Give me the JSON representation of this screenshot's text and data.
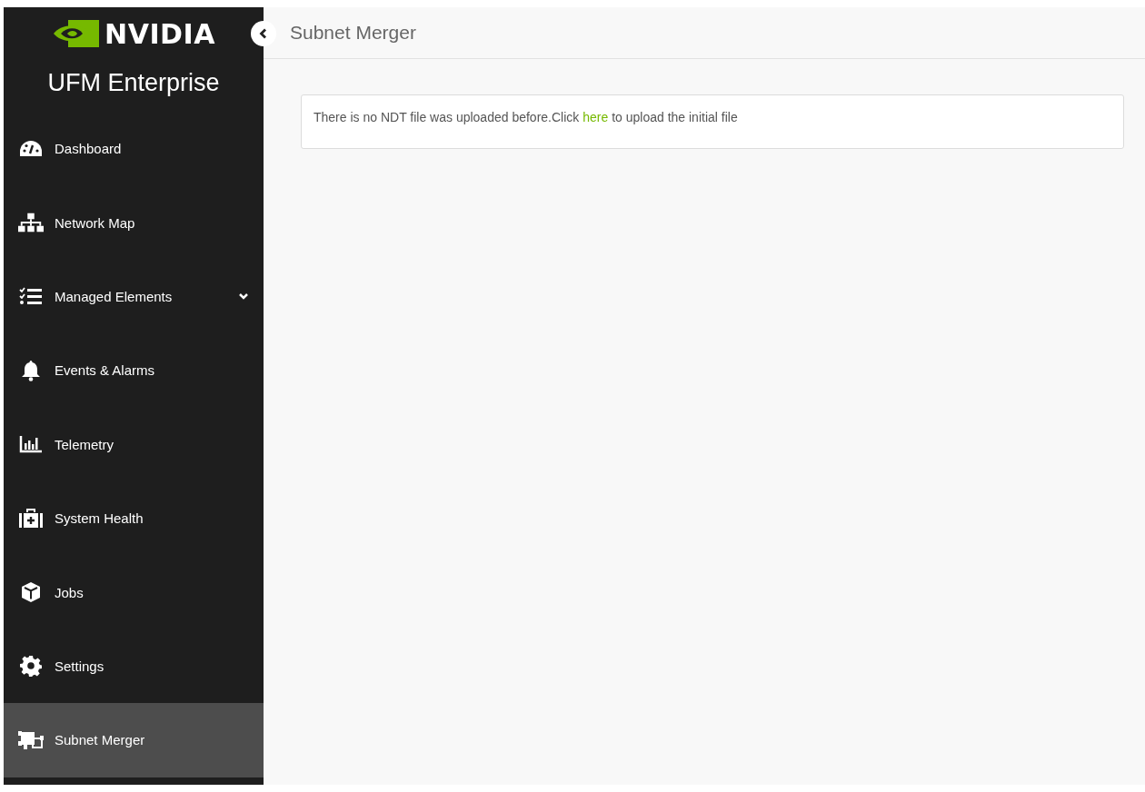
{
  "sidebar": {
    "brand": "NVIDIA",
    "product": "UFM Enterprise",
    "items": [
      {
        "label": "Dashboard",
        "selected": false,
        "expandable": false
      },
      {
        "label": "Network Map",
        "selected": false,
        "expandable": false
      },
      {
        "label": "Managed Elements",
        "selected": false,
        "expandable": true
      },
      {
        "label": "Events & Alarms",
        "selected": false,
        "expandable": false
      },
      {
        "label": "Telemetry",
        "selected": false,
        "expandable": false
      },
      {
        "label": "System Health",
        "selected": false,
        "expandable": false
      },
      {
        "label": "Jobs",
        "selected": false,
        "expandable": false
      },
      {
        "label": "Settings",
        "selected": false,
        "expandable": false
      },
      {
        "label": "Subnet Merger",
        "selected": true,
        "expandable": false
      }
    ]
  },
  "header": {
    "title": "Subnet Merger"
  },
  "message": {
    "before": "There is no NDT file was uploaded before.Click ",
    "link": "here",
    "after": " to upload the initial file"
  }
}
